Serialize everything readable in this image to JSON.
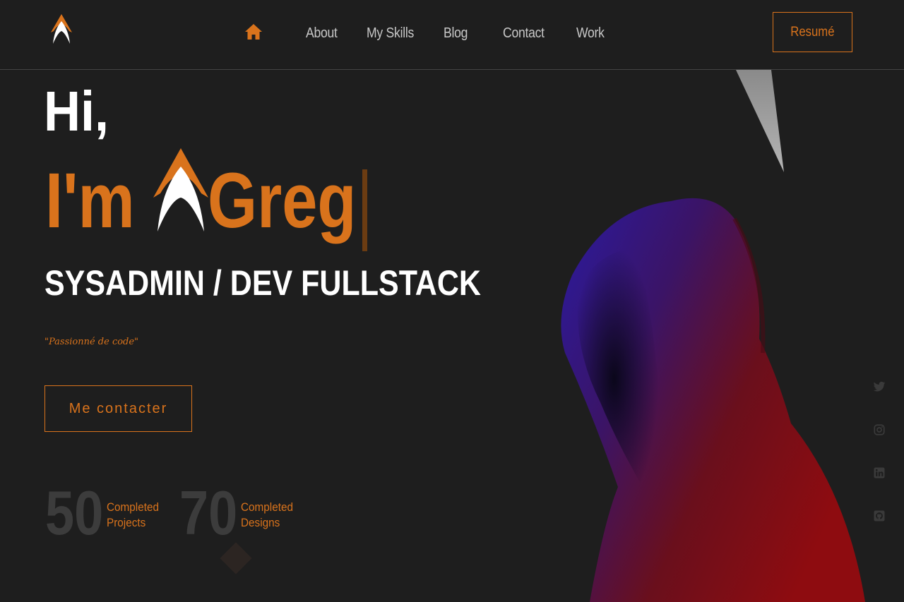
{
  "nav": {
    "items": [
      {
        "label": "About"
      },
      {
        "label": "My Skills"
      },
      {
        "label": "Blog"
      },
      {
        "label": "Contact"
      },
      {
        "label": "Work"
      }
    ],
    "resume_label": "Resumé"
  },
  "hero": {
    "greeting": "Hi,",
    "im": "I'm",
    "name": "Greg",
    "subtitle": "SYSADMIN / DEV FULLSTACK",
    "quote": "\"Passionné de code\"",
    "cta_label": "Me contacter"
  },
  "stats": [
    {
      "number": "50",
      "label_line1": "Completed",
      "label_line2": "Projects"
    },
    {
      "number": "70",
      "label_line1": "Completed",
      "label_line2": "Designs"
    }
  ],
  "social": [
    "twitter-icon",
    "instagram-icon",
    "linkedin-icon",
    "github-icon"
  ],
  "colors": {
    "background": "#1e1e1e",
    "accent": "#d9731c",
    "text": "#ffffff",
    "muted": "#c8c8c8",
    "stat_number": "#3c3c3c"
  }
}
